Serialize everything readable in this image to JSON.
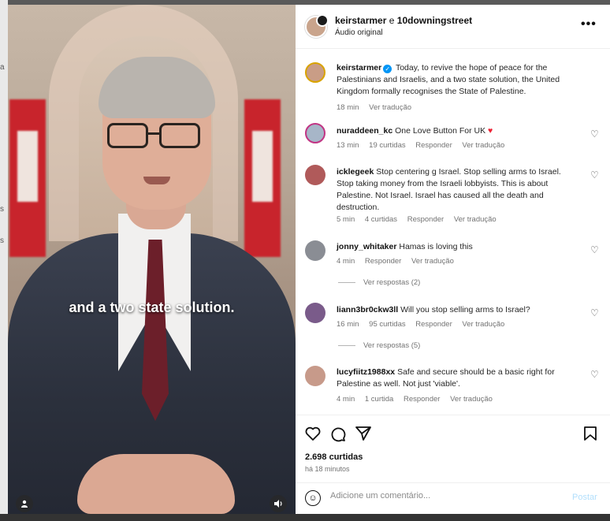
{
  "post": {
    "author": "keirstarmer",
    "joiner": "e",
    "coauthor": "10downingstreet",
    "audio": "Áudio original",
    "more_icon": "more-horizontal-icon",
    "caption_overlay": "and a two state solution."
  },
  "caption": {
    "username": "keirstarmer",
    "verified": true,
    "text": "Today, to revive the hope of peace for the Palestinians and Israelis, and a two state solution, the United Kingdom formally recognises the State of Palestine.",
    "time": "18 min",
    "translate": "Ver tradução"
  },
  "comments": [
    {
      "username": "nuraddeen_kc",
      "text": "One Love Button For UK",
      "emoji": "♥",
      "time": "13 min",
      "likes": "19 curtidas",
      "reply": "Responder",
      "translate": "Ver tradução"
    },
    {
      "username": "icklegeek",
      "text": "Stop centering g Israel. Stop selling arms to Israel. Stop taking money from the Israeli lobbyists. This is about Palestine. Not Israel. Israel has caused all the death and destruction.",
      "time": "5 min",
      "likes": "4 curtidas",
      "reply": "Responder",
      "translate": "Ver tradução"
    },
    {
      "username": "jonny_whitaker",
      "text": "Hamas is loving this",
      "time": "4 min",
      "reply": "Responder",
      "translate": "Ver tradução",
      "view_replies": "Ver respostas (2)"
    },
    {
      "username": "liann3br0ckw3ll",
      "text": "Will you stop selling arms to Israel?",
      "time": "16 min",
      "likes": "95 curtidas",
      "reply": "Responder",
      "translate": "Ver tradução",
      "view_replies": "Ver respostas (5)"
    },
    {
      "username": "lucyfiitz1988xx",
      "text": "Safe and secure should be a basic right for Palestine as well. Not just 'viable'.",
      "time": "4 min",
      "likes": "1 curtida",
      "reply": "Responder",
      "translate": "Ver tradução"
    }
  ],
  "actions": {
    "likes": "2.698 curtidas",
    "posted": "há 18 minutos",
    "icons": [
      "heart-icon",
      "comment-icon",
      "share-icon",
      "bookmark-icon"
    ]
  },
  "composer": {
    "placeholder": "Adicione um comentário...",
    "post_label": "Postar"
  },
  "colors": {
    "accent": "#0095f6",
    "post_disabled": "#b2dffc",
    "like_red": "#ed1f32"
  }
}
